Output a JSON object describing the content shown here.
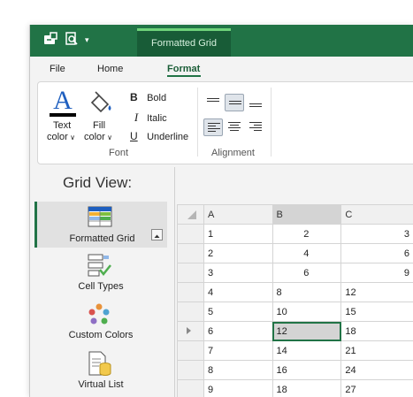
{
  "title_tab": "Formatted Grid",
  "menu": {
    "tabs": [
      "File",
      "Home",
      "Format"
    ],
    "active": "Format"
  },
  "ribbon": {
    "font_group": {
      "label": "Font",
      "text_color": [
        "Text",
        "color"
      ],
      "fill_color": [
        "Fill",
        "color"
      ],
      "bold": "Bold",
      "italic": "Italic",
      "underline": "Underline",
      "bold_glyph": "B",
      "italic_glyph": "I",
      "underline_glyph": "U"
    },
    "alignment_group": {
      "label": "Alignment"
    }
  },
  "sidebar": {
    "title": "Grid View:",
    "items": [
      {
        "label": "Formatted Grid",
        "icon": "formatted-grid-icon",
        "selected": true
      },
      {
        "label": "Cell Types",
        "icon": "cell-types-icon"
      },
      {
        "label": "Custom Colors",
        "icon": "custom-colors-icon"
      },
      {
        "label": "Virtual List",
        "icon": "virtual-list-icon"
      }
    ]
  },
  "grid": {
    "columns": [
      "A",
      "B",
      "C"
    ],
    "rows": [
      [
        "1",
        "2",
        "3"
      ],
      [
        "2",
        "4",
        "6"
      ],
      [
        "3",
        "6",
        "9"
      ],
      [
        "4",
        "8",
        "12"
      ],
      [
        "5",
        "10",
        "15"
      ],
      [
        "6",
        "12",
        "18"
      ],
      [
        "7",
        "14",
        "21"
      ],
      [
        "8",
        "16",
        "24"
      ],
      [
        "9",
        "18",
        "27"
      ]
    ]
  }
}
